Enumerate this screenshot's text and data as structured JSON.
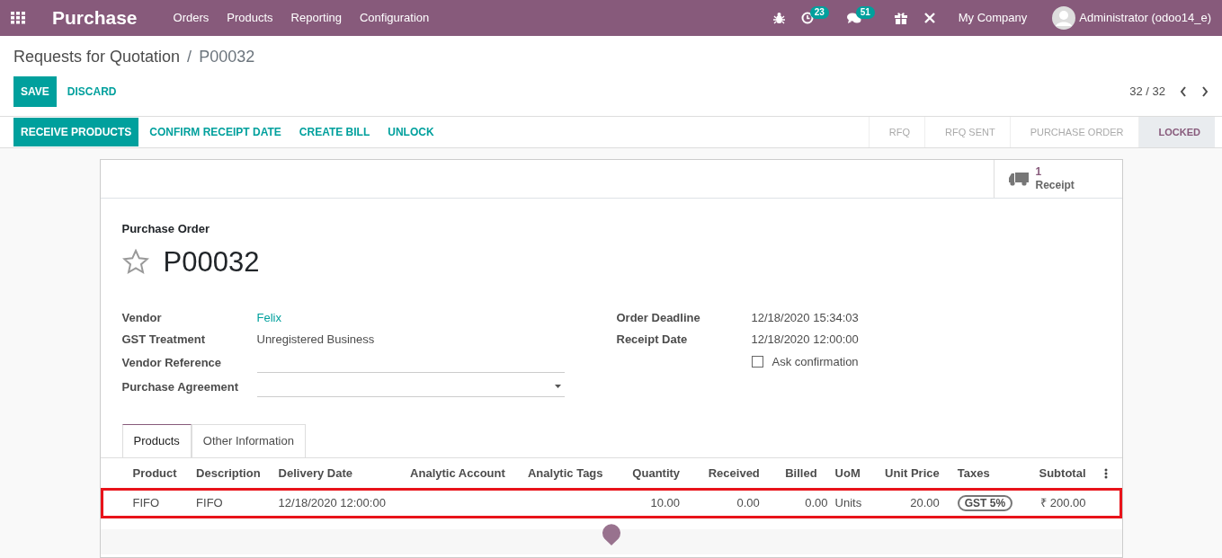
{
  "navbar": {
    "app_name": "Purchase",
    "menu": [
      "Orders",
      "Products",
      "Reporting",
      "Configuration"
    ],
    "activity_count": "23",
    "message_count": "51",
    "company": "My Company",
    "user": "Administrator (odoo14_e)"
  },
  "breadcrumb": {
    "parent": "Requests for Quotation",
    "separator": "/",
    "current": "P00032"
  },
  "form_buttons": [
    {
      "label": "SAVE",
      "primary": true
    },
    {
      "label": "DISCARD",
      "primary": false
    }
  ],
  "pager": "32 / 32",
  "actions": [
    {
      "label": "RECEIVE PRODUCTS",
      "primary": true
    },
    {
      "label": "CONFIRM RECEIPT DATE",
      "primary": false
    },
    {
      "label": "CREATE BILL",
      "primary": false
    },
    {
      "label": "UNLOCK",
      "primary": false
    }
  ],
  "statusbar": [
    {
      "label": "RFQ",
      "selected": false
    },
    {
      "label": "RFQ SENT",
      "selected": false
    },
    {
      "label": "PURCHASE ORDER",
      "selected": false
    },
    {
      "label": "LOCKED",
      "selected": true
    }
  ],
  "smart_button": {
    "count": "1",
    "label": "Receipt"
  },
  "sheet": {
    "title_label": "Purchase Order",
    "name": "P00032",
    "starred": false
  },
  "left_fields": [
    {
      "label": "Vendor",
      "value": "Felix",
      "kind": "link"
    },
    {
      "label": "GST Treatment",
      "value": "Unregistered Business",
      "kind": "text"
    },
    {
      "label": "Vendor Reference",
      "kind": "input"
    },
    {
      "label": "Purchase Agreement",
      "kind": "select"
    }
  ],
  "right_fields": [
    {
      "label": "Order Deadline",
      "value": "12/18/2020 15:34:03",
      "kind": "text"
    },
    {
      "label": "Receipt Date",
      "value": "12/18/2020 12:00:00",
      "kind": "text"
    }
  ],
  "ask_confirmation": {
    "label": "Ask confirmation",
    "checked": false
  },
  "tabs": [
    {
      "label": "Products",
      "selected": true
    },
    {
      "label": "Other Information",
      "selected": false
    }
  ],
  "table": {
    "columns": [
      {
        "label": "Product",
        "kind": "text"
      },
      {
        "label": "Description",
        "kind": "text"
      },
      {
        "label": "Delivery Date",
        "kind": "text"
      },
      {
        "label": "Analytic Account",
        "kind": "text"
      },
      {
        "label": "Analytic Tags",
        "kind": "text"
      },
      {
        "label": "Quantity",
        "kind": "number"
      },
      {
        "label": "Received",
        "kind": "number"
      },
      {
        "label": "Billed",
        "kind": "number"
      },
      {
        "label": "UoM",
        "kind": "text"
      },
      {
        "label": "Unit Price",
        "kind": "number"
      },
      {
        "label": "Taxes",
        "kind": "tag"
      },
      {
        "label": "Subtotal",
        "kind": "number"
      }
    ],
    "rows": [
      {
        "highlighted": true,
        "cells": [
          "FIFO",
          "FIFO",
          "12/18/2020 12:00:00",
          "",
          "",
          "10.00",
          "0.00",
          "0.00",
          "Units",
          "20.00",
          "GST 5%",
          "₹ 200.00"
        ]
      }
    ]
  }
}
